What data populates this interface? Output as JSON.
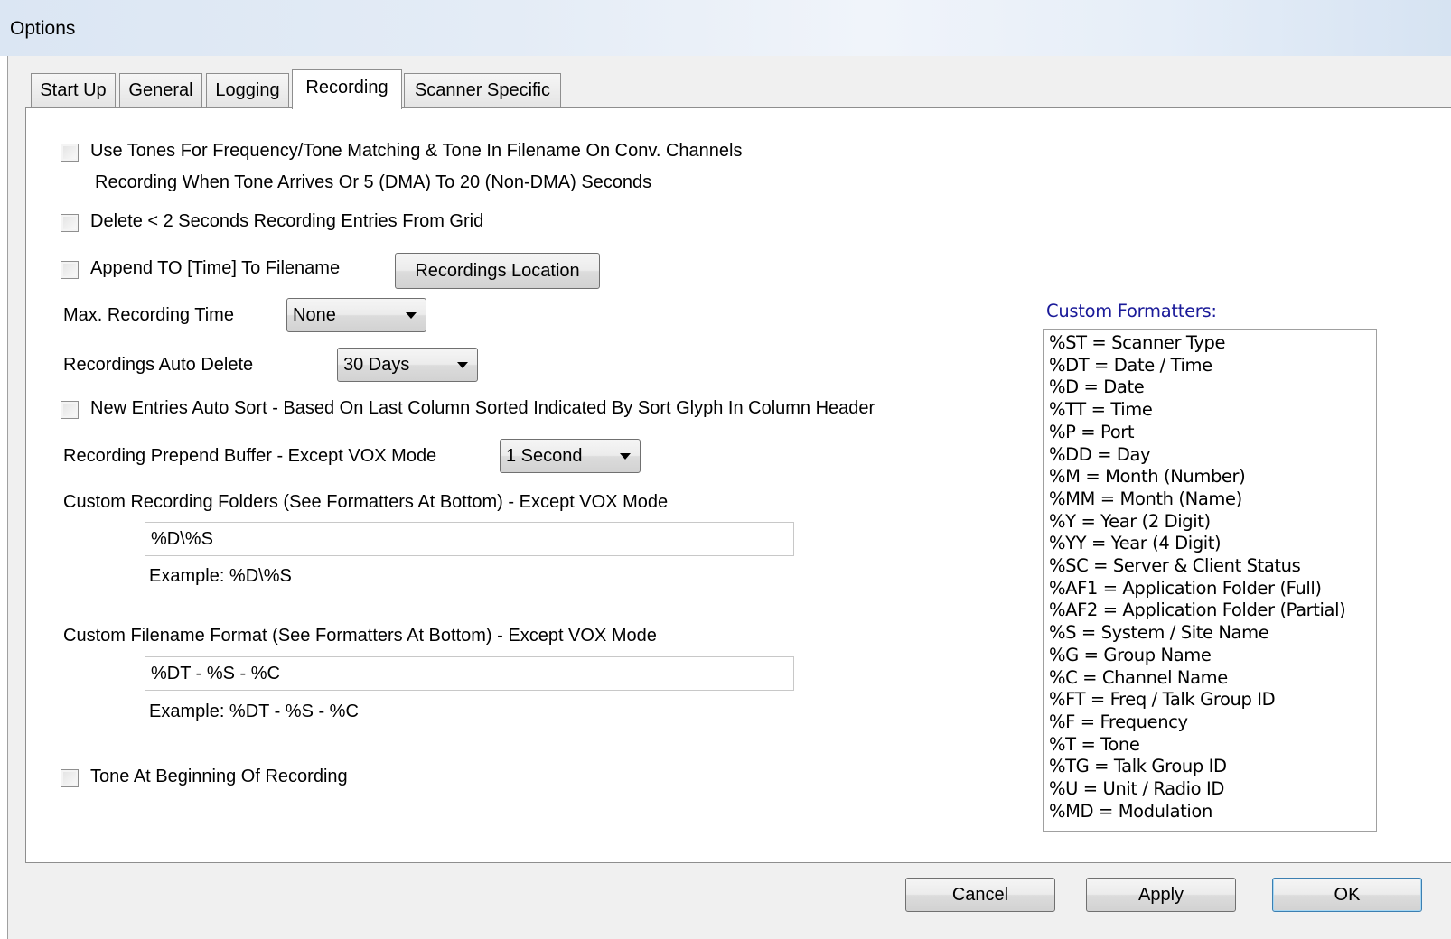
{
  "window": {
    "title": "Options"
  },
  "tabs": [
    {
      "label": "Start Up"
    },
    {
      "label": "General"
    },
    {
      "label": "Logging"
    },
    {
      "label": "Recording",
      "active": true
    },
    {
      "label": "Scanner Specific"
    }
  ],
  "recording": {
    "use_tones": {
      "label": "Use Tones For Frequency/Tone Matching & Tone In Filename On Conv. Channels",
      "checked": false
    },
    "use_tones_note": "Recording When Tone Arrives Or 5 (DMA) To 20 (Non-DMA) Seconds",
    "delete_short": {
      "label": "Delete < 2 Seconds Recording Entries From Grid",
      "checked": false
    },
    "append_to": {
      "label": "Append TO [Time] To Filename",
      "checked": false
    },
    "recordings_location_button": "Recordings Location",
    "max_recording_time": {
      "label": "Max. Recording Time",
      "value": "None"
    },
    "auto_delete": {
      "label": "Recordings Auto Delete",
      "value": "30 Days"
    },
    "auto_sort": {
      "label": "New Entries Auto Sort - Based On Last Column Sorted Indicated By Sort Glyph In Column Header",
      "checked": false
    },
    "prepend_buffer": {
      "label": "Recording Prepend Buffer  - Except VOX Mode",
      "value": "1 Second"
    },
    "custom_folders": {
      "label": "Custom Recording Folders (See Formatters At Bottom) - Except VOX Mode",
      "value": "%D\\%S",
      "example": "Example:  %D\\%S"
    },
    "custom_filename": {
      "label": "Custom Filename Format (See Formatters At Bottom) - Except VOX Mode",
      "value": "%DT - %S - %C",
      "example": "Example:  %DT - %S - %C"
    },
    "tone_at_beginning": {
      "label": "Tone At Beginning Of Recording",
      "checked": false
    }
  },
  "formatters": {
    "title": "Custom Formatters:",
    "items": [
      "%ST = Scanner Type",
      "%DT = Date / Time",
      "%D = Date",
      "%TT = Time",
      "%P = Port",
      "%DD = Day",
      "%M = Month (Number)",
      "%MM = Month (Name)",
      "%Y = Year (2 Digit)",
      "%YY = Year (4 Digit)",
      "%SC = Server & Client Status",
      "%AF1 = Application Folder (Full)",
      "%AF2 = Application Folder (Partial)",
      "%S = System / Site Name",
      "%G = Group Name",
      "%C = Channel Name",
      "%FT = Freq / Talk Group ID",
      "%F = Frequency",
      "%T = Tone",
      "%TG = Talk Group ID",
      "%U = Unit / Radio ID",
      "%MD = Modulation"
    ]
  },
  "buttons": {
    "cancel": "Cancel",
    "apply": "Apply",
    "ok": "OK"
  },
  "colors": {
    "formatters_title": "#1a1a99",
    "title_bar": "#dbe6f3",
    "panel_bg": "#f0f0f0"
  }
}
